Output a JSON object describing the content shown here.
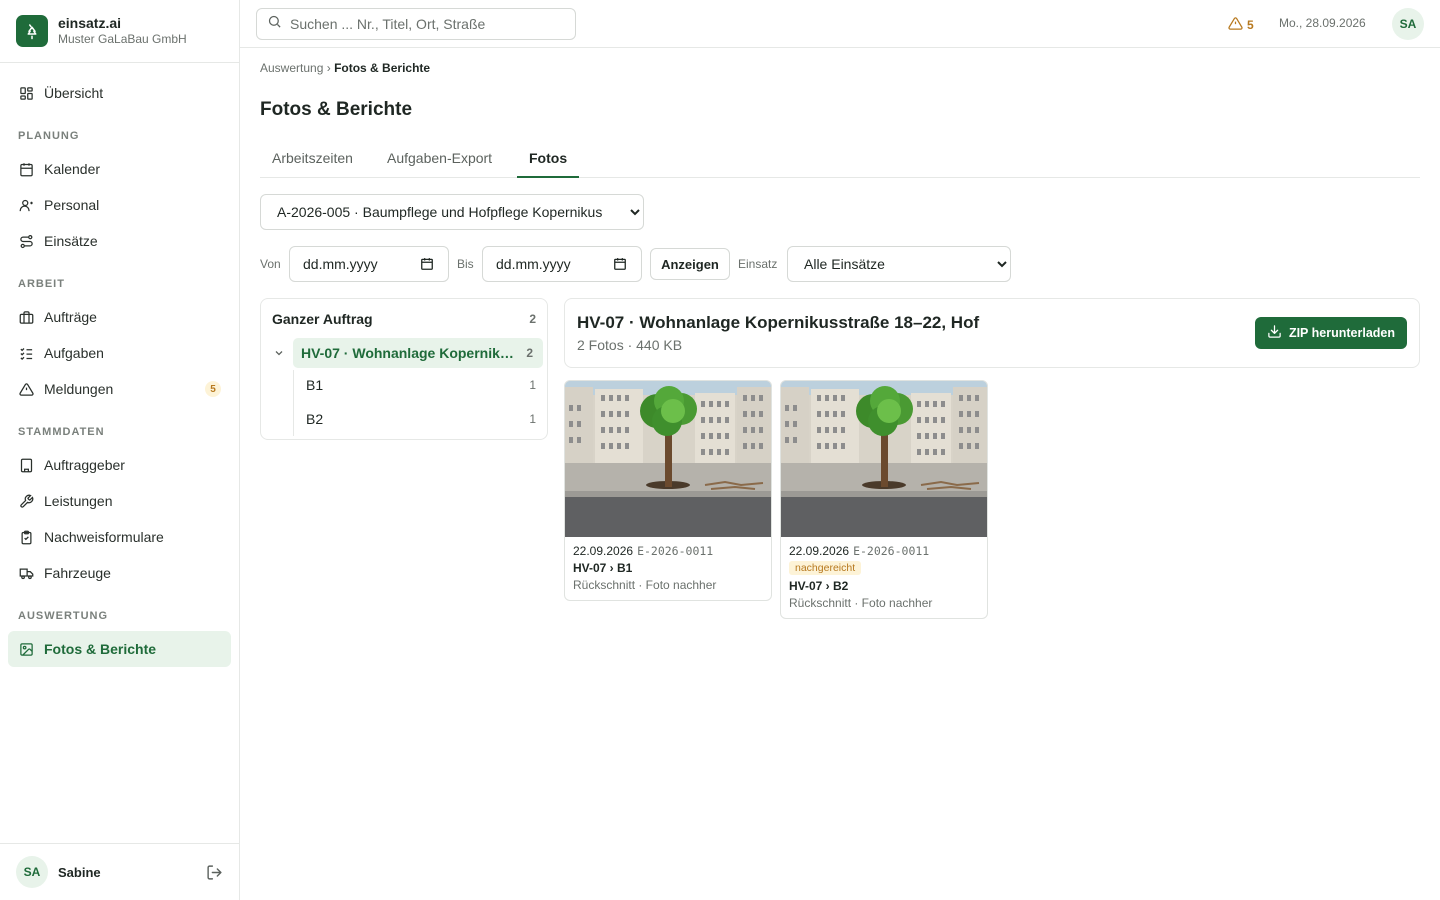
{
  "brand": {
    "name": "einsatz.ai",
    "company": "Muster GaLaBau GmbH"
  },
  "nav": {
    "overview": "Übersicht",
    "sections": {
      "planning": "PLANUNG",
      "work": "ARBEIT",
      "master": "STAMMDATEN",
      "evaluation": "AUSWERTUNG"
    },
    "items": {
      "calendar": "Kalender",
      "staff": "Personal",
      "deployments": "Einsätze",
      "orders": "Aufträge",
      "tasks": "Aufgaben",
      "reports": "Meldungen",
      "reports_badge": "5",
      "clients": "Auftraggeber",
      "services": "Leistungen",
      "forms": "Nachweisformulare",
      "vehicles": "Fahrzeuge",
      "photos": "Fotos & Berichte"
    }
  },
  "user": {
    "initials": "SA",
    "name": "Sabine"
  },
  "topbar": {
    "search_placeholder": "Suchen ... Nr., Titel, Ort, Straße",
    "alert_count": "5",
    "date": "Mo., 28.09.2026",
    "avatar": "SA"
  },
  "breadcrumb": {
    "parent": "Auswertung",
    "separator": "›",
    "current": "Fotos & Berichte"
  },
  "page_title": "Fotos & Berichte",
  "tabs": [
    "Arbeitszeiten",
    "Aufgaben-Export",
    "Fotos"
  ],
  "filters": {
    "order_selected": "A-2026-005 · Baumpflege und Hofpflege Kopernikus",
    "from_label": "Von",
    "to_label": "Bis",
    "date_placeholder": "dd.mm.yyyy",
    "show_button": "Anzeigen",
    "einsatz_label": "Einsatz",
    "einsatz_selected": "Alle Einsätze"
  },
  "tree": {
    "root": {
      "label": "Ganzer Auftrag",
      "count": "2"
    },
    "hv": {
      "label": "HV-07 · Wohnanlage Kopernikusstraße 18–22, Hof",
      "count": "2"
    },
    "leaves": [
      {
        "label": "B1",
        "count": "1"
      },
      {
        "label": "B2",
        "count": "1"
      }
    ]
  },
  "detail": {
    "title": "HV-07 · Wohnanlage Kopernikusstraße 18–22, Hof",
    "meta": "2 Fotos · 440 KB",
    "zip_button": "ZIP herunterladen"
  },
  "photos": [
    {
      "date": "22.09.2026",
      "code": "E-2026-0011",
      "tag": "",
      "location": "HV-07 › B1",
      "description": "Rückschnitt · Foto nachher"
    },
    {
      "date": "22.09.2026",
      "code": "E-2026-0011",
      "tag": "nachgereicht",
      "location": "HV-07 › B2",
      "description": "Rückschnitt · Foto nachher"
    }
  ],
  "colors": {
    "primary": "#1f6b3a",
    "primary_light": "#e8f3ea",
    "warning": "#b7791f",
    "warning_bg": "#fdf3d7"
  }
}
